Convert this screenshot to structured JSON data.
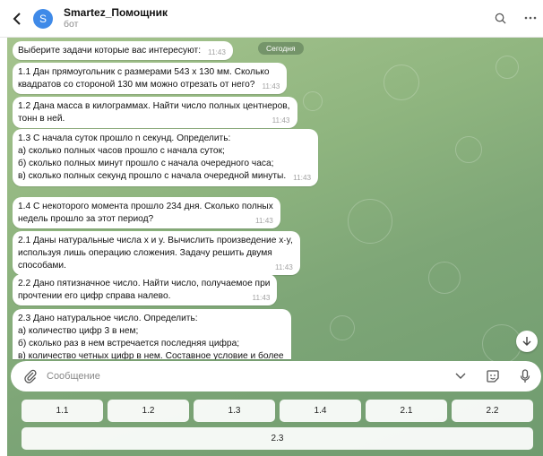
{
  "header": {
    "back_icon": "chevron-left-icon",
    "avatar_letter": "S",
    "title": "Smartez_Помощник",
    "subtitle": "бот",
    "search_icon": "search-icon",
    "more_icon": "more-horizontal-icon"
  },
  "date_pill": "Сегодня",
  "messages": [
    {
      "text": "Выберите задачи которые вас интересуют:",
      "time": "11:43"
    },
    {
      "text": "1.1 Дан прямоугольник с размерами 543 х 130 мм. Сколько\nквадратов со стороной 130 мм можно отрезать от него?",
      "time": "11:43"
    },
    {
      "text": "1.2 Дана масса в килограммах. Найти число полных центнеров,\nтонн в ней.",
      "time": "11:43"
    },
    {
      "text": "1.3 С начала суток прошло n секунд. Определить:\nа) сколько полных часов прошло с начала суток;\nб) сколько полных минут прошло с начала очередного часа;\nв) сколько полных секунд прошло с начала очередной минуты.",
      "time": "11:43"
    },
    {
      "text": "1.4 С некоторого момента прошло 234 дня. Сколько полных\nнедель прошло за этот период?",
      "time": "11:43"
    },
    {
      "text": "2.1 Даны натуральные числа x и y. Вычислить произведение x·y,\nиспользуя лишь операцию сложения. Задачу решить двумя\nспособами.",
      "time": "11:43"
    },
    {
      "text": "2.2 Дано пятизначное число. Найти число, получаемое при\nпрочтении его цифр справа налево.",
      "time": "11:43"
    },
    {
      "text": "2.3 Дано натуральное число. Определить:\nа) количество цифр 3 в нем;\nб) сколько раз в нем встречается последняя цифра;\nв) количество четных цифр в нем. Составное условие и более",
      "time": ""
    }
  ],
  "input": {
    "placeholder": "Сообщение",
    "value": ""
  },
  "keyboard": {
    "row1": [
      "1.1",
      "1.2",
      "1.3",
      "1.4",
      "2.1",
      "2.2"
    ],
    "row2": [
      "2.3"
    ]
  },
  "colors": {
    "accent": "#3f8ae8",
    "chat_bg": "#8fb57f"
  }
}
